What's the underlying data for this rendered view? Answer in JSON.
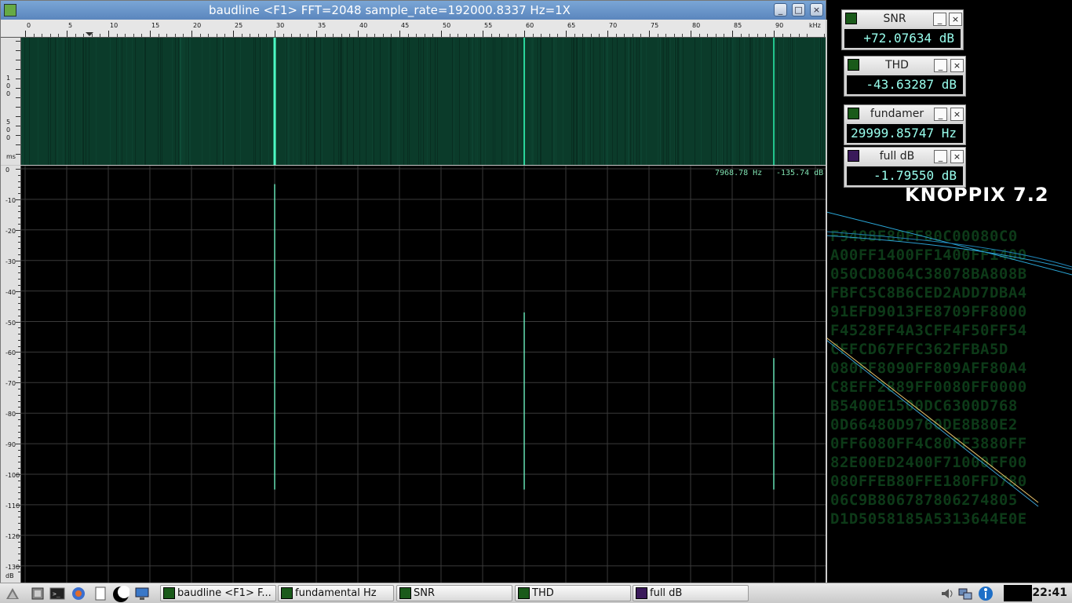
{
  "window": {
    "title": "baudline  <F1> FFT=2048 sample_rate=192000.8337 Hz=1X",
    "buttons": [
      "minimize",
      "maximize",
      "close"
    ]
  },
  "freq_ruler": {
    "labels": [
      "0",
      "5",
      "10",
      "15",
      "20",
      "25",
      "30",
      "35",
      "40",
      "45",
      "50",
      "55",
      "60",
      "65",
      "70",
      "75",
      "80",
      "85",
      "90"
    ],
    "unit": "kHz"
  },
  "waterfall_scale": {
    "labels": [
      "1",
      "0",
      "0",
      "5",
      "0",
      "0",
      "ms"
    ]
  },
  "spectrum": {
    "cursor_freq": "7968.78 Hz",
    "cursor_level": "-135.74 dB",
    "db_labels": [
      "0",
      "-10",
      "-20",
      "-30",
      "-40",
      "-50",
      "-60",
      "-70",
      "-80",
      "-90",
      "-100",
      "-110",
      "-120",
      "-130",
      "dB"
    ]
  },
  "meters": [
    {
      "label": "SNR",
      "value": "+72.07634 dB"
    },
    {
      "label": "THD",
      "value": "-43.63287 dB"
    },
    {
      "label": "fundamer",
      "value": "29999.85747 Hz"
    },
    {
      "label": "full dB",
      "value": "-1.79550 dB"
    }
  ],
  "desktop": {
    "brand": "KNOPPIX 7.2",
    "hex_lines": [
      "F9408F80FF80C00080C0",
      "A00FF1400FF1400FF1400",
      "050CD8064C38078BA808B",
      "FBFC5C8B6CED2ADD7DBA4",
      "91EFD9013FE8709FF8000",
      "F4528FF4A3CFF4F50FF54",
      "CFFCD67FFC362FFBA5D",
      "080FF8090FF809AFF80A4",
      "C8EFF2889FF0080FF0000",
      "B5400E1500DC6300D768",
      "0D66480D9760DE8B80E2",
      "0FF6080FF4C80FF3880FF",
      "82E00ED2400F71000FF00",
      "080FFEB80FFE180FFD780",
      "06C9B806787806274805",
      "D1D5058185A5313644E0E"
    ]
  },
  "taskbar": {
    "tasks": [
      "baudline  <F1> F...",
      "fundamental Hz",
      "SNR",
      "THD",
      "full dB"
    ],
    "clock": "22:41"
  },
  "chart_data": {
    "type": "line",
    "title": "",
    "xlabel": "kHz",
    "ylabel": "dB",
    "xlim": [
      0,
      96
    ],
    "ylim": [
      -130,
      0
    ],
    "grid": true,
    "peaks": [
      {
        "x": 30.0,
        "y": -5
      },
      {
        "x": 60.0,
        "y": -47
      },
      {
        "x": 90.0,
        "y": -62
      }
    ],
    "noise_floor": -105
  }
}
